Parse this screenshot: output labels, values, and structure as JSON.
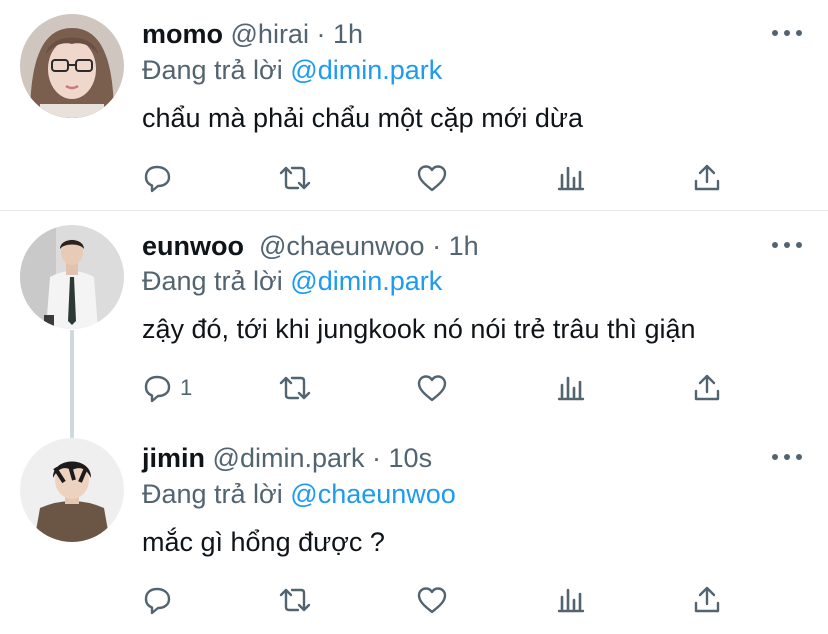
{
  "tweets": [
    {
      "name": "momo",
      "handle": "@hirai",
      "separator": "·",
      "time": "1h",
      "reply_prefix": "Đang trả lời",
      "reply_to": "@dimin.park",
      "text": "chẩu mà phải chẩu một cặp mới dừa",
      "actions": {
        "reply_count": "",
        "retweet_count": "",
        "like_count": ""
      }
    },
    {
      "name": "eunwoo",
      "handle": "@chaeunwoo",
      "separator": "·",
      "time": "1h",
      "reply_prefix": "Đang trả lời",
      "reply_to": "@dimin.park",
      "text": "zậy đó, tới khi jungkook nó nói trẻ trâu thì giận",
      "actions": {
        "reply_count": "1",
        "retweet_count": "",
        "like_count": ""
      }
    },
    {
      "name": "jimin",
      "handle": "@dimin.park",
      "separator": "·",
      "time": "10s",
      "reply_prefix": "Đang trả lời",
      "reply_to": "@chaeunwoo",
      "text": "mắc gì hổng được ?",
      "actions": {
        "reply_count": "",
        "retweet_count": "",
        "like_count": ""
      }
    }
  ],
  "icons": {
    "reply": "reply-icon",
    "retweet": "retweet-icon",
    "like": "heart-icon",
    "views": "analytics-icon",
    "share": "share-icon",
    "more": "more-icon"
  },
  "colors": {
    "text": "#0f1419",
    "secondary": "#536471",
    "accent": "#1d9bf0",
    "divider": "#e7e9ea",
    "thread_line": "#cfd9de"
  }
}
